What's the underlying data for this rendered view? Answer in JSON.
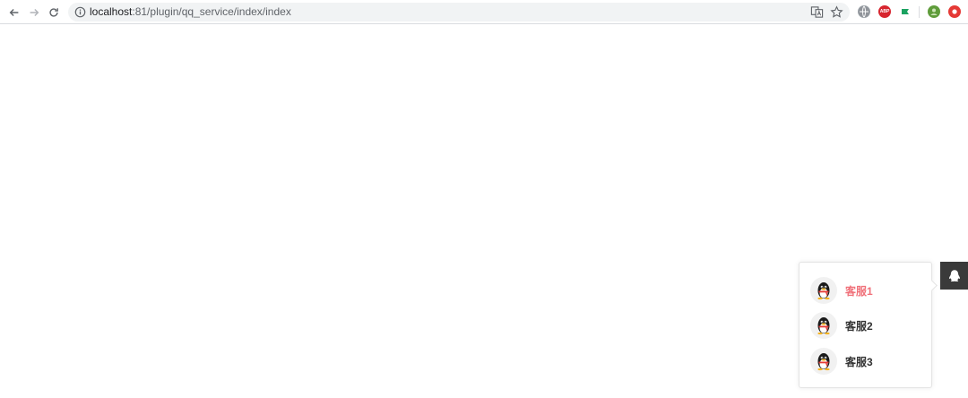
{
  "browser": {
    "url_host": "localhost",
    "url_rest": ":81/plugin/qq_service/index/index",
    "extensions": [
      {
        "name": "globe-extension",
        "color": "#9aa0a6",
        "text": ""
      },
      {
        "name": "adblock-plus",
        "color": "#d7252f",
        "text": "ABP"
      },
      {
        "name": "green-flag-extension",
        "color": "#1aa260",
        "text": ""
      },
      {
        "name": "profile-avatar",
        "color": "#5f9c3b",
        "text": ""
      },
      {
        "name": "red-extension",
        "color": "#e53935",
        "text": ""
      }
    ]
  },
  "qq_service": {
    "items": [
      {
        "label": "客服1",
        "active": true
      },
      {
        "label": "客服2",
        "active": false
      },
      {
        "label": "客服3",
        "active": false
      }
    ],
    "colors": {
      "active": "#f0717a",
      "normal": "#333333",
      "tab_bg": "#3a3a3a"
    }
  }
}
